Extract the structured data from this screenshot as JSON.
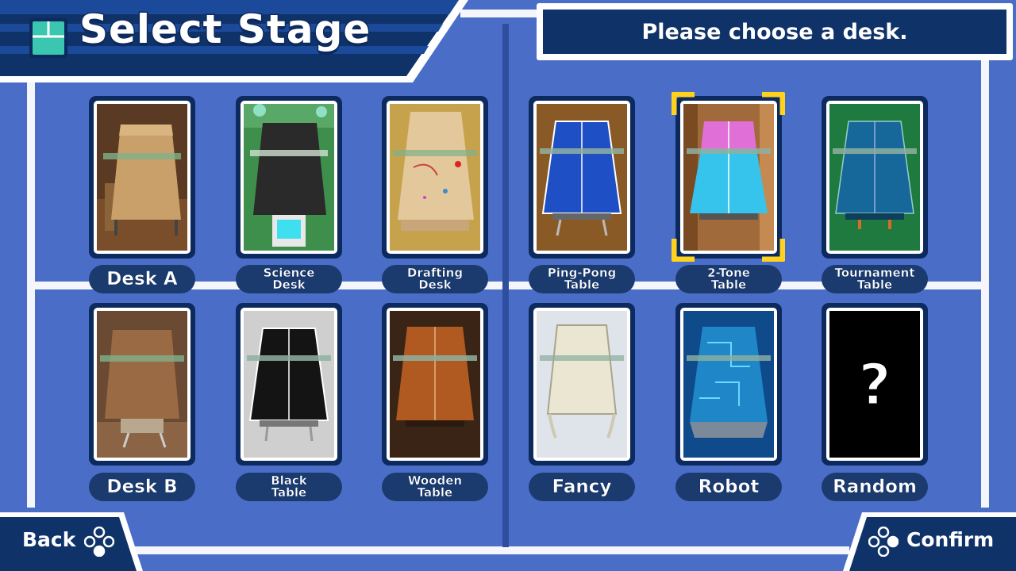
{
  "header": {
    "title": "Select Stage",
    "prompt": "Please choose a desk."
  },
  "stages": [
    {
      "id": "desk-a",
      "label": "Desk A",
      "label2": ""
    },
    {
      "id": "science-desk",
      "label": "Science",
      "label2": "Desk"
    },
    {
      "id": "drafting-desk",
      "label": "Drafting",
      "label2": "Desk"
    },
    {
      "id": "ping-pong-table",
      "label": "Ping-Pong",
      "label2": "Table"
    },
    {
      "id": "two-tone-table",
      "label": "2-Tone",
      "label2": "Table"
    },
    {
      "id": "tournament-table",
      "label": "Tournament",
      "label2": "Table"
    },
    {
      "id": "desk-b",
      "label": "Desk B",
      "label2": ""
    },
    {
      "id": "black-table",
      "label": "Black",
      "label2": "Table"
    },
    {
      "id": "wooden-table",
      "label": "Wooden",
      "label2": "Table"
    },
    {
      "id": "fancy",
      "label": "Fancy",
      "label2": ""
    },
    {
      "id": "robot",
      "label": "Robot",
      "label2": ""
    },
    {
      "id": "random",
      "label": "Random",
      "label2": ""
    }
  ],
  "selected_stage": "2-Tone Table",
  "footer": {
    "back_label": "Back",
    "confirm_label": "Confirm"
  },
  "colors": {
    "background": "#4a6ec8",
    "navy": "#0d2a5e",
    "highlight": "#ffd21e"
  }
}
